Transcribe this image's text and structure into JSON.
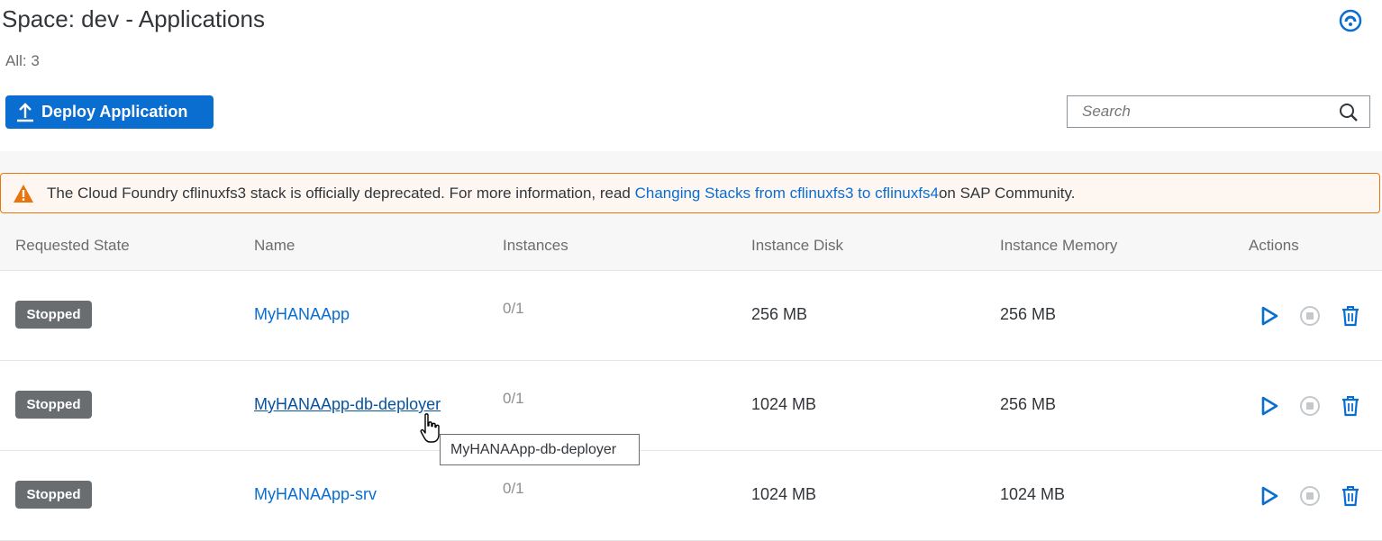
{
  "header": {
    "title": "Space: dev - Applications",
    "count": "All: 3"
  },
  "toolbar": {
    "deploy_label": "Deploy Application",
    "search_placeholder": "Search"
  },
  "warning": {
    "text_before": "The Cloud Foundry cflinuxfs3 stack is officially deprecated. For more information, read ",
    "link": "Changing Stacks from cflinuxfs3 to cflinuxfs4",
    "text_after": " on SAP Community."
  },
  "table": {
    "columns": [
      "Requested State",
      "Name",
      "Instances",
      "Instance Disk",
      "Instance Memory",
      "Actions"
    ],
    "rows": [
      {
        "state": "Stopped",
        "name": "MyHANAApp",
        "instances": "0/1",
        "disk": "256 MB",
        "memory": "256 MB"
      },
      {
        "state": "Stopped",
        "name": "MyHANAApp-db-deployer",
        "instances": "0/1",
        "disk": "1024 MB",
        "memory": "256 MB"
      },
      {
        "state": "Stopped",
        "name": "MyHANAApp-srv",
        "instances": "0/1",
        "disk": "1024 MB",
        "memory": "1024 MB"
      }
    ]
  },
  "tooltip": {
    "text": "MyHANAApp-db-deployer"
  },
  "icons": {
    "help": "help-icon",
    "deploy": "upload-icon",
    "search": "search-icon",
    "warning": "warning-icon",
    "start": "play-icon",
    "stop": "stop-icon",
    "delete": "trash-icon",
    "cursor": "hand-pointer-icon"
  },
  "colors": {
    "accent": "#0a6ed1",
    "warning": "#e9730c",
    "badge": "#6a6d70"
  }
}
